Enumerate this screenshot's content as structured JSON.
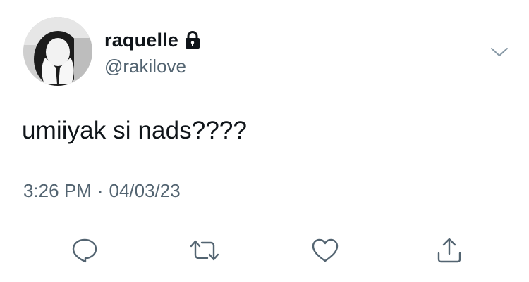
{
  "tweet": {
    "display_name": "raquelle",
    "handle": "@rakilove",
    "text": "umiiyak si nads????",
    "time": "3:26 PM",
    "separator": "·",
    "date": "04/03/23"
  },
  "icons": {
    "lock": "lock-icon",
    "more": "chevron-down-icon",
    "reply": "reply-icon",
    "retweet": "retweet-icon",
    "like": "heart-icon",
    "share": "share-icon"
  },
  "colors": {
    "text_primary": "#0f1419",
    "text_secondary": "#536471",
    "divider": "#e4e7ea"
  }
}
